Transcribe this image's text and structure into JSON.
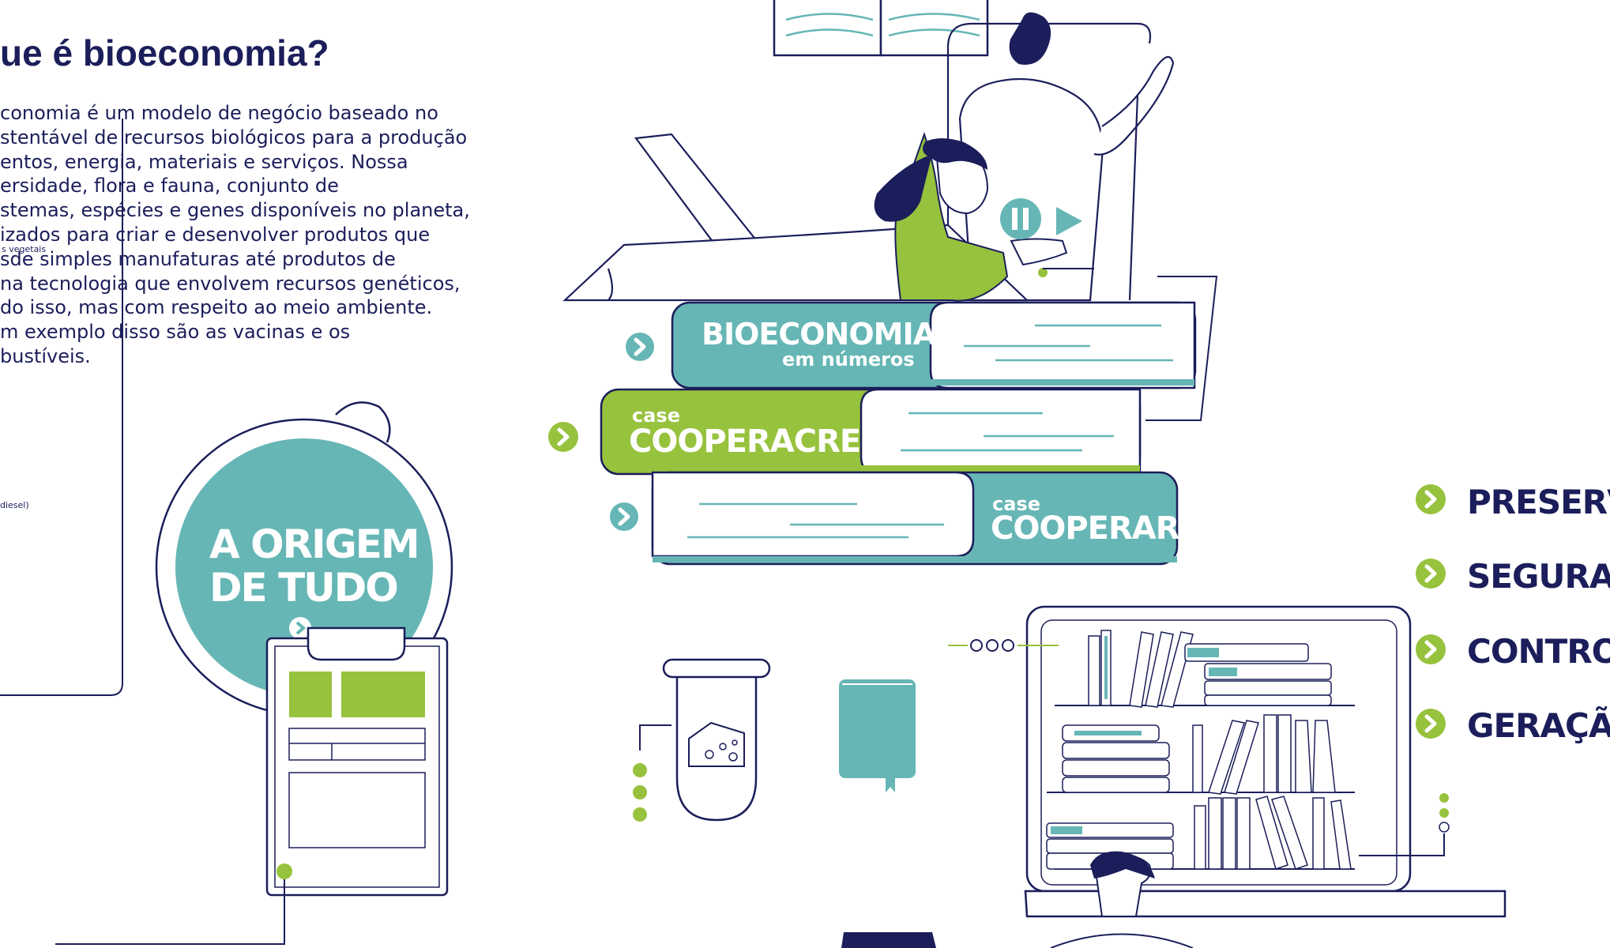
{
  "intro": {
    "title": "ue é bioeconomia?",
    "lines": [
      "conomia é um modelo de negócio baseado no",
      "stentável de recursos biológicos para a produção",
      "entos, energia, materiais e serviços. Nossa",
      "ersidade, flora e fauna, conjunto de",
      "stemas, espécies e genes disponíveis no planeta,",
      "izados  para criar e desenvolver produtos que",
      "sde simples manufaturas até produtos de",
      "na tecnologia que envolvem recursos genéticos,",
      "do isso,  mas com respeito ao meio ambiente.",
      "m exemplo disso são as vacinas e os",
      "bustíveis."
    ],
    "tiny_note_1": "s vegetais",
    "tiny_note_2": "diesel)"
  },
  "books": {
    "bioeconomia": {
      "title": "BIOECONOMIA",
      "subtitle": "em números"
    },
    "cooperacre": {
      "prefix": "case",
      "title": "COOPERACRE"
    },
    "cooperar": {
      "prefix": "case",
      "title": "COOPERAR"
    }
  },
  "origem": {
    "line1": "A ORIGEM",
    "line2": "DE TUDO"
  },
  "topics": [
    "PRESERVA",
    "SEGURAN",
    "CONTROL",
    "GERAÇÃO"
  ],
  "colors": {
    "navy": "#1b1e5a",
    "teal": "#66b6b5",
    "green": "#97c23d",
    "white": "#ffffff"
  },
  "icons": [
    "chevron-right-icon",
    "pause-icon",
    "play-icon",
    "book-icon",
    "test-tube-icon",
    "cheese-icon",
    "open-book-icon",
    "clipboard-icon"
  ]
}
